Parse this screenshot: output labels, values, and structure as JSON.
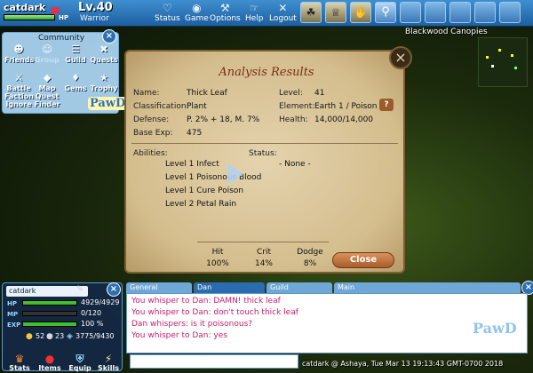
{
  "player": {
    "name": "catdark",
    "level": "Lv.40",
    "class": "Warrior",
    "hp_tag": "HP",
    "hp_fraction": 1.0
  },
  "topnav": [
    {
      "label": "Status",
      "icon": "heart-icon"
    },
    {
      "label": "Game",
      "icon": "game-controller-icon"
    },
    {
      "label": "Options",
      "icon": "wrench-icon"
    },
    {
      "label": "Help",
      "icon": "help-icon"
    },
    {
      "label": "Logout",
      "icon": "logout-icon"
    }
  ],
  "community": {
    "title": "Community",
    "buttons": [
      {
        "label": "Friends",
        "icon": "friends-icon"
      },
      {
        "label": "Group",
        "icon": "group-icon",
        "disabled": true
      },
      {
        "label": "Guild",
        "icon": "guild-icon"
      },
      {
        "label": "Quests",
        "icon": "quests-icon"
      },
      {
        "label": "Battle Faction Ignore",
        "l1": "Battle",
        "l2": "Faction",
        "l3": "Ignore",
        "icon": "battle-icon"
      },
      {
        "label": "Map Quest Finder",
        "l1": "Map",
        "l2": "Quest",
        "l3": "Finder",
        "icon": "map-icon"
      },
      {
        "label": "Gems",
        "icon": "gems-icon"
      },
      {
        "label": "Trophy",
        "icon": "trophy-icon"
      }
    ],
    "logo": "PawD"
  },
  "location": "Blackwood Canopies",
  "analysis": {
    "title": "Analysis Results",
    "name_label": "Name:",
    "name": "Thick Leaf",
    "level_label": "Level:",
    "level": "41",
    "class_label": "Classification:",
    "classification": "Plant",
    "element_label": "Element:",
    "element": "Earth 1 / Poison",
    "defense_label": "Defense:",
    "defense": "P. 2% + 18, M. 7%",
    "health_label": "Health:",
    "health": "14,000/14,000",
    "base_exp_label": "Base Exp:",
    "base_exp": "475",
    "abilities_label": "Abilities:",
    "abilities": [
      "Level 1 Infect",
      "Level 1 Poisonous Blood",
      "Level 1 Cure Poison",
      "Level 2 Petal Rain"
    ],
    "status_label": "Status:",
    "status": "- None -",
    "help": "?",
    "stats": [
      {
        "head": "Hit",
        "value": "100%"
      },
      {
        "head": "Crit",
        "value": "14%"
      },
      {
        "head": "Dodge",
        "value": "8%"
      }
    ],
    "close_label": "Close"
  },
  "stats_panel": {
    "name": "catdark",
    "hp": {
      "tag": "HP",
      "value": "4929/4929",
      "fraction": 1.0,
      "color": "#3fbf2e"
    },
    "mp": {
      "tag": "MP",
      "value": "0/120",
      "fraction": 0.0,
      "color": "#3f7fdf"
    },
    "exp": {
      "tag": "EXP",
      "value": "100 %",
      "fraction": 1.0,
      "color": "#3fbf2e"
    },
    "coins_a": "52",
    "coins_b": "23",
    "gold": "3775/9430",
    "buttons": [
      {
        "label": "Stats",
        "icon": "stats-icon"
      },
      {
        "label": "Items",
        "icon": "items-icon"
      },
      {
        "label": "Equip",
        "icon": "equip-icon"
      },
      {
        "label": "Skills",
        "icon": "skills-icon"
      }
    ]
  },
  "chat": {
    "tabs": [
      "General",
      "Dan",
      "Guild",
      "Main"
    ],
    "active_tab": "Dan",
    "lines": [
      "You whisper to Dan: DAMN! thick leaf",
      "You whisper to Dan: don't touch thick leaf",
      "Dan whispers: is it poisonous?",
      "You whisper to Dan: yes"
    ],
    "input_value": "",
    "status": "catdark @ Ashaya, Tue Mar 13 19:13:43 GMT-0700 2018",
    "logo": "PawD"
  }
}
